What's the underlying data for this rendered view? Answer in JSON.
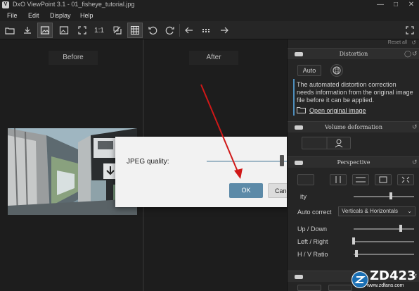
{
  "window": {
    "title": "DxO ViewPoint 3.1 - 01_fisheye_tutorial.jpg",
    "app_icon": "V",
    "controls": [
      "—",
      "□",
      "✕"
    ]
  },
  "menu": [
    "File",
    "Edit",
    "Display",
    "Help"
  ],
  "toolbar": {
    "zoom_label": "1:1",
    "icons": [
      "open-folder-icon",
      "export-icon",
      "before-after-icon",
      "image-icon",
      "fit-icon",
      "zoom-1-1",
      "compare-icon",
      "grid-icon",
      "rotate-left-icon",
      "rotate-right-icon",
      "previous-icon",
      "filmstrip-icon",
      "next-icon",
      "fullscreen-icon"
    ]
  },
  "viewer": {
    "before_label": "Before",
    "after_label": "After"
  },
  "dialog": {
    "label": "JPEG quality:",
    "quality_fraction": 0.82,
    "ok_label": "OK",
    "cancel_label": "Cancel"
  },
  "panel": {
    "reset_all": "Reset all",
    "distortion": {
      "title": "Distortion",
      "auto_label": "Auto",
      "info_text": "The automated distortion correction needs information from the original image file before it can be applied.",
      "link_text": "Open original image"
    },
    "volume": {
      "title": "Volume deformation"
    },
    "perspective": {
      "title": "Perspective",
      "intensity_label": "ity",
      "intensity_value": 0.62,
      "auto_correct_label": "Auto correct",
      "auto_correct_value": "Verticals & Horizontals",
      "up_down_label": "Up / Down",
      "up_down_value": 0.78,
      "left_right_label": "Left / Right",
      "left_right_value": 0.0,
      "hv_ratio_label": "H / V Ratio",
      "hv_ratio_value": 0.05
    }
  },
  "watermark": {
    "brand": "ZD423",
    "url": "www.zdfans.com"
  },
  "colors": {
    "accent": "#5c8aa8",
    "info_bar": "#4f8fbd",
    "arrow": "#d01818"
  }
}
